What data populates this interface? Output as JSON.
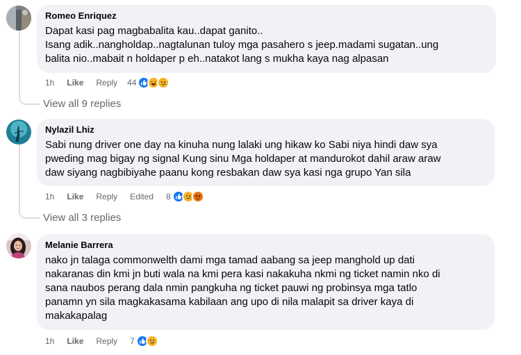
{
  "comments": [
    {
      "author": "Romeo Enriquez",
      "text": "Dapat kasi pag magbabalita kau..dapat ganito..\nIsang adik..nangholdap..nagtalunan tuloy mga pasahero s jeep.madami sugatan..ung\nbalita nio..mabait n holdaper p eh..natakot lang s mukha kaya nag alpasan",
      "time": "1h",
      "like_label": "Like",
      "reply_label": "Reply",
      "reaction_count": "44",
      "reactions": [
        "like-icon",
        "haha-icon",
        "sad-icon"
      ],
      "view_replies": "View all 9 replies"
    },
    {
      "author": "Nylazil Lhiz",
      "text": "Sabi nung driver one day na kinuha nung lalaki ung hikaw ko Sabi niya hindi daw sya\npweding mag bigay ng signal Kung sinu Mga holdaper at mandurokot dahil araw araw\ndaw siyang nagbibiyahe paanu kong resbakan daw sya kasi nga grupo Yan sila",
      "time": "1h",
      "like_label": "Like",
      "reply_label": "Reply",
      "edited_label": "Edited",
      "reaction_count": "8",
      "reactions": [
        "like-icon",
        "sad-icon",
        "angry-icon"
      ],
      "view_replies": "View all 3 replies"
    },
    {
      "author": "Melanie Barrera",
      "text": "nako jn talaga commonwelth dami mga tamad aabang sa jeep manghold up dati\nnakaranas din kmi jn buti wala na kmi pera kasi nakakuha nkmi ng ticket namin nko di\nsana naubos perang dala nmin pangkuha ng ticket pauwi ng probinsya mga tatlo\npanamn yn sila magkakasama kabilaan ang upo di nila malapit sa driver kaya di\nmakakapalag",
      "time": "1h",
      "like_label": "Like",
      "reply_label": "Reply",
      "reaction_count": "7",
      "reactions": [
        "like-icon",
        "sad-icon"
      ]
    }
  ],
  "colors": {
    "bubble": "#f0f2f5",
    "secondary_text": "#65676b",
    "like_blue": "#1877f2",
    "emoji_yellow": "#f7b125",
    "angry_red": "#e9710f"
  }
}
